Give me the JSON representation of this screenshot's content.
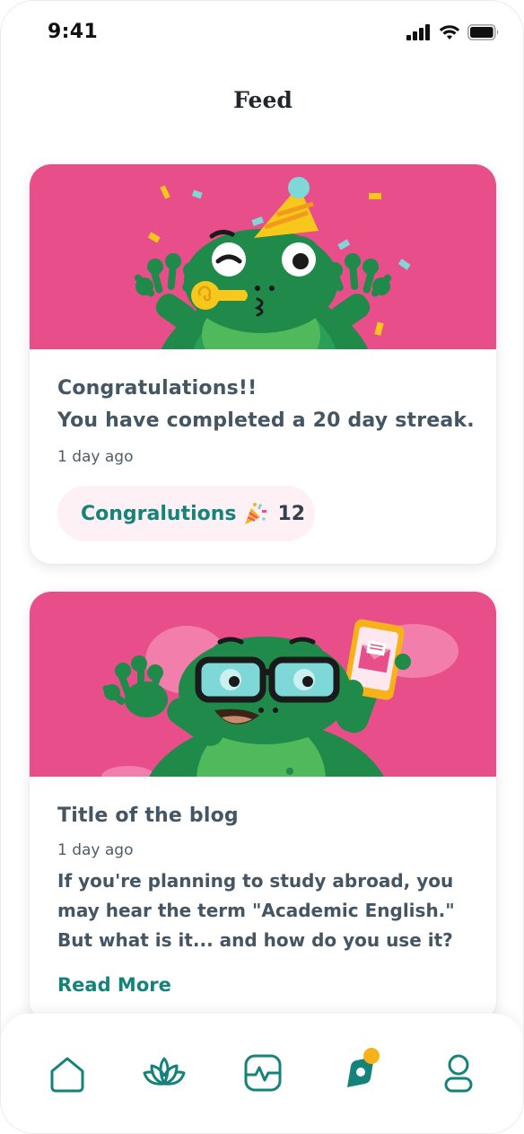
{
  "status_bar": {
    "time": "9:41"
  },
  "page": {
    "title": "Feed"
  },
  "feed": [
    {
      "type": "achievement",
      "title": "Congratulations!!\nYou have completed a 20 day streak.",
      "title_line1": "Congratulations!!",
      "title_line2": "You have completed a 20 day streak.",
      "time": "1 day ago",
      "reaction": {
        "label": "Congralutions",
        "emoji": "party-popper-icon",
        "count": "12"
      }
    },
    {
      "type": "blog",
      "title": "Title of the blog",
      "time": "1 day ago",
      "excerpt": "If you're planning to study abroad, you may hear the term \"Academic English.\" But what is it... and how do you use it?",
      "read_more": "Read More"
    }
  ],
  "bottom_nav": {
    "items": [
      {
        "icon": "home-icon",
        "active": false
      },
      {
        "icon": "lotus-icon",
        "active": false
      },
      {
        "icon": "heart-rate-icon",
        "active": false
      },
      {
        "icon": "feed-icon",
        "active": true,
        "badge": true
      },
      {
        "icon": "profile-icon",
        "active": false
      }
    ]
  },
  "colors": {
    "accent": "#16837a",
    "hero_background": "#e84e8a",
    "text": "#445563",
    "badge": "#f7b21b"
  }
}
